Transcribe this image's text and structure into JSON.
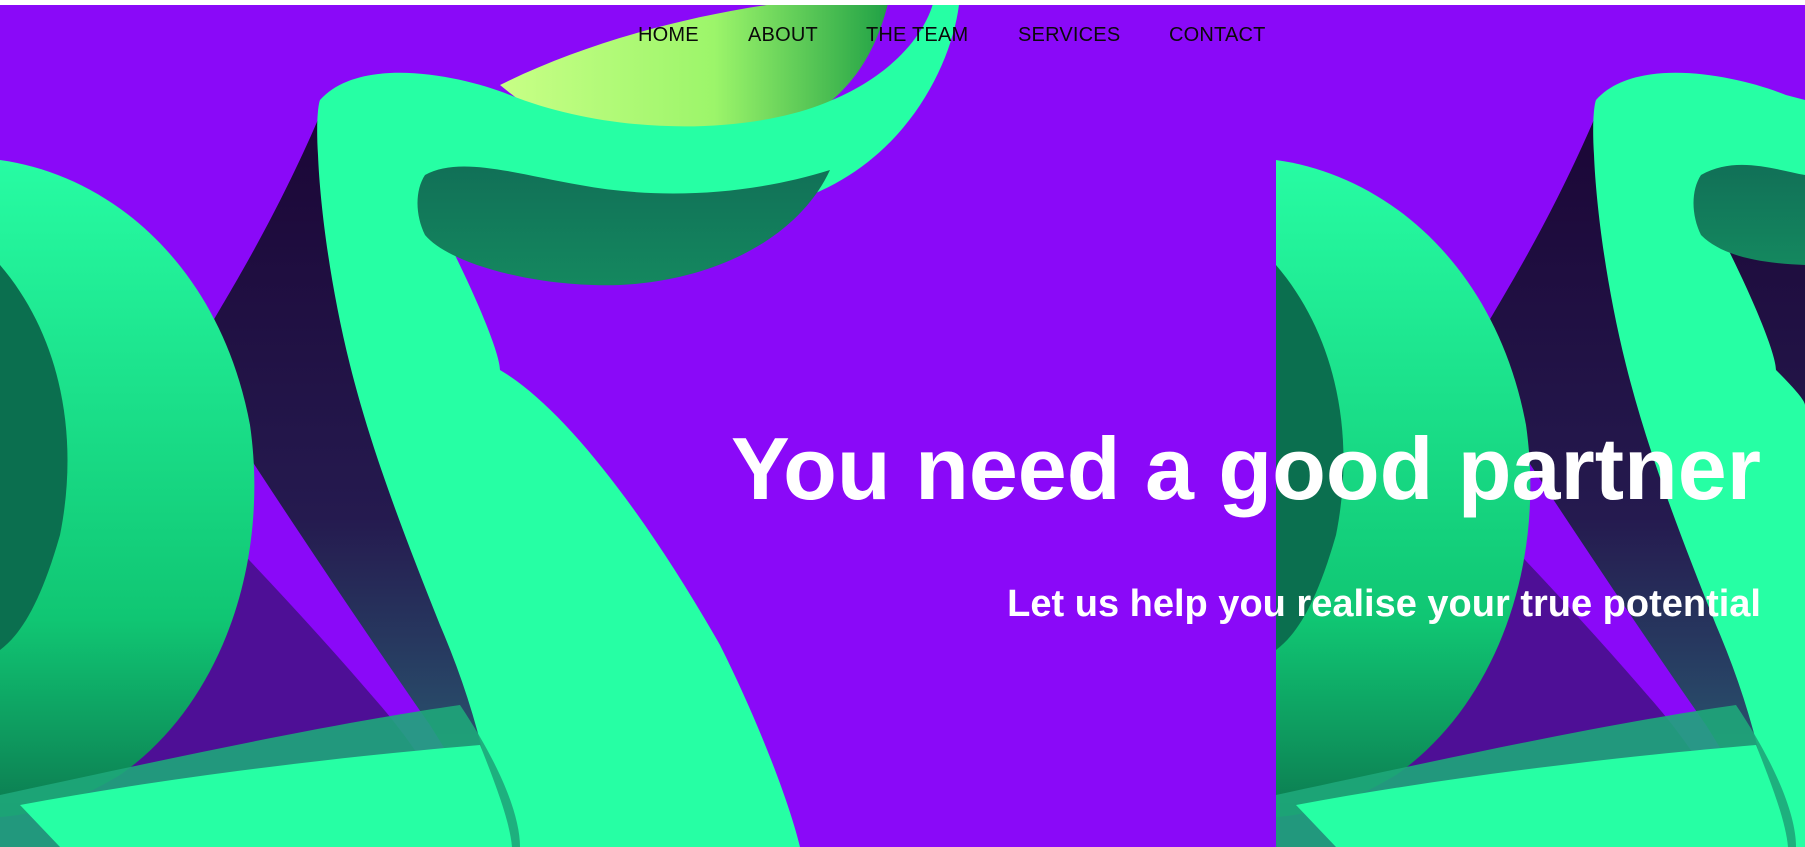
{
  "nav": {
    "items": [
      {
        "label": "HOME"
      },
      {
        "label": "ABOUT"
      },
      {
        "label": "THE TEAM"
      },
      {
        "label": "SERVICES"
      },
      {
        "label": "CONTACT"
      }
    ]
  },
  "hero": {
    "title": "You need a good partner",
    "subtitle": "Let us help you realise your true potential"
  },
  "colors": {
    "background": "#8a09f8",
    "shape_green": "#26ffa4",
    "shape_dark": "#2a0a46",
    "shape_lime": "#b7ff70",
    "nav_text": "#0a0a0a",
    "hero_text": "#ffffff"
  }
}
